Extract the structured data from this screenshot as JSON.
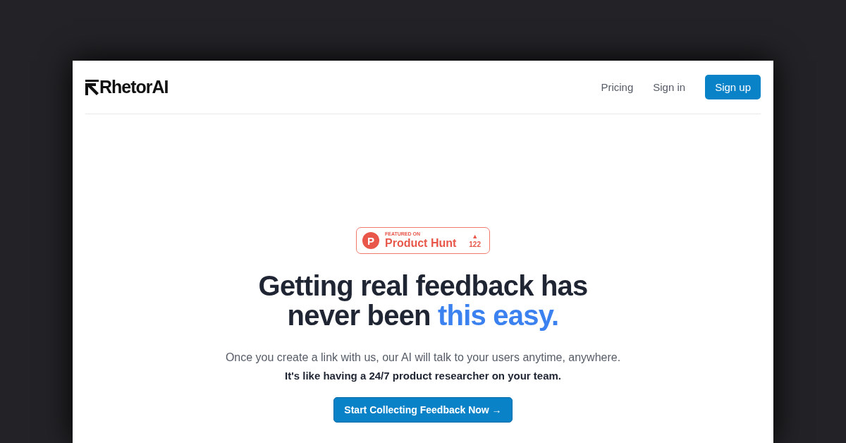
{
  "header": {
    "logo": "RhetorAI",
    "nav": [
      "Pricing",
      "Sign in"
    ],
    "signup": "Sign up"
  },
  "badge": {
    "caption": "FEATURED ON",
    "name": "Product Hunt",
    "letter": "P",
    "arrow": "▲",
    "count": "122"
  },
  "headline": {
    "lines": [
      [
        {
          "text": "Getting real feedback has",
          "highlight": false
        }
      ],
      [
        {
          "text": "never been ",
          "highlight": false
        },
        {
          "text": "this easy.",
          "highlight": true
        }
      ]
    ]
  },
  "intro": "Once you create a link with us, our AI will talk to your users anytime, anywhere.",
  "tagline": "It's like having a 24/7 product researcher on your team.",
  "cta": "Start Collecting Feedback Now →"
}
